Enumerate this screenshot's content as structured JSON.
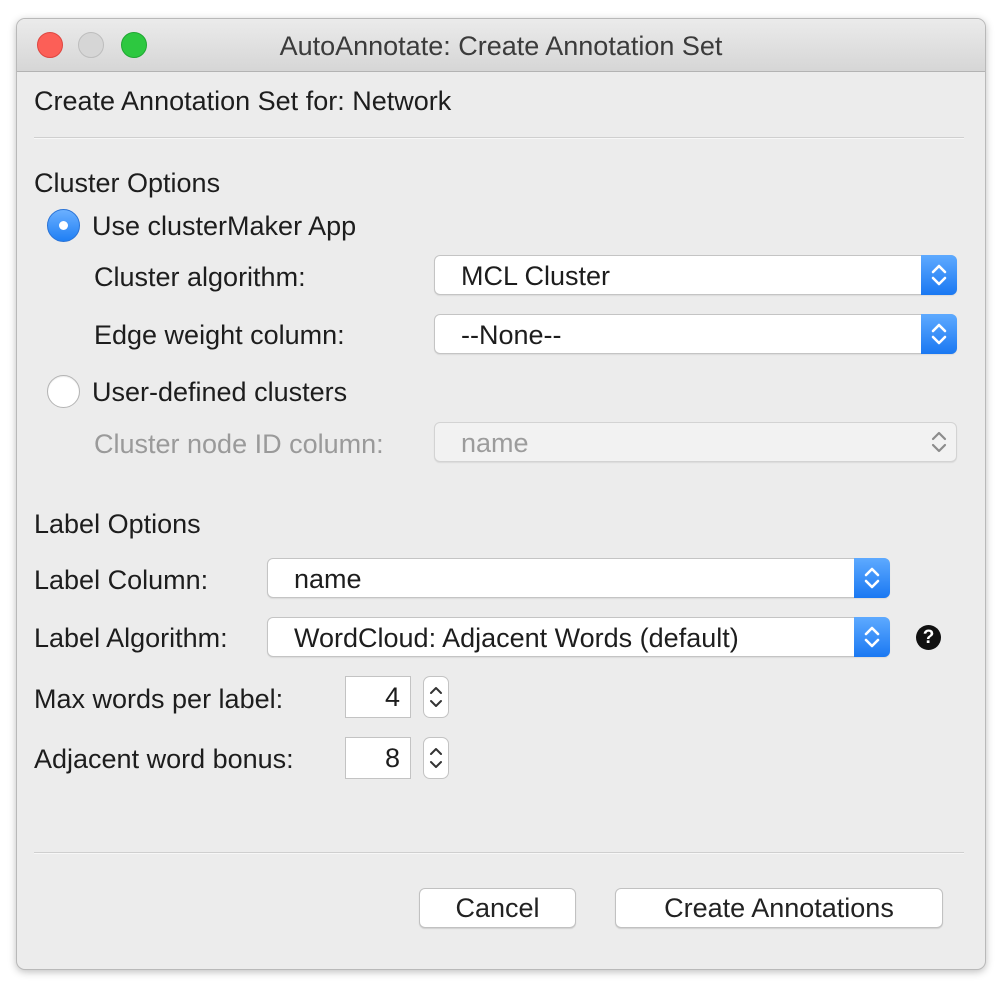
{
  "window": {
    "title": "AutoAnnotate: Create Annotation Set"
  },
  "header": {
    "text": "Create Annotation Set for: Network"
  },
  "cluster_options": {
    "heading": "Cluster Options",
    "use_clustermaker": {
      "label": "Use clusterMaker App",
      "selected": true
    },
    "cluster_algorithm": {
      "label": "Cluster algorithm:",
      "value": "MCL Cluster"
    },
    "edge_weight_column": {
      "label": "Edge weight column:",
      "value": "--None--"
    },
    "user_defined": {
      "label": "User-defined clusters",
      "selected": false
    },
    "cluster_node_id_column": {
      "label": "Cluster node ID column:",
      "value": "name",
      "enabled": false
    }
  },
  "label_options": {
    "heading": "Label Options",
    "label_column": {
      "label": "Label Column:",
      "value": "name"
    },
    "label_algorithm": {
      "label": "Label Algorithm:",
      "value": "WordCloud: Adjacent Words (default)"
    },
    "max_words": {
      "label": "Max words per label:",
      "value": "4"
    },
    "adjacent_bonus": {
      "label": "Adjacent word bonus:",
      "value": "8"
    }
  },
  "buttons": {
    "cancel": "Cancel",
    "create": "Create Annotations"
  },
  "colors": {
    "accent": "#1f7ff4",
    "close": "#fc5f57",
    "maximize": "#2dc840"
  }
}
